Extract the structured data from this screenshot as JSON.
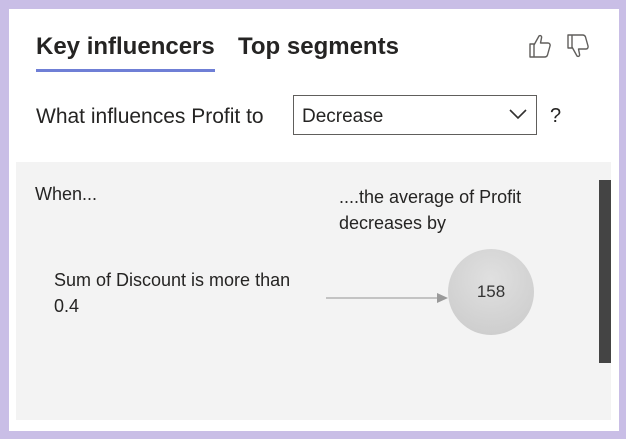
{
  "tabs": [
    {
      "label": "Key influencers",
      "active": true
    },
    {
      "label": "Top segments",
      "active": false
    }
  ],
  "question": {
    "label": "What influences Profit to",
    "dropdown_value": "Decrease",
    "help": "?"
  },
  "panel": {
    "when_header": "When...",
    "result_header": "....the average of Profit decreases by",
    "influencers": [
      {
        "condition": "Sum of Discount is more than 0.4",
        "value": "158"
      }
    ]
  },
  "icons": [
    "thumbs-up-icon",
    "thumbs-down-icon",
    "chevron-down-icon",
    "arrow-right-icon"
  ],
  "colors": {
    "background": "#c9bee6",
    "tab_underline": "#6f7fd6",
    "panel": "#f3f3f3",
    "bubble": "#d3d3d3"
  }
}
